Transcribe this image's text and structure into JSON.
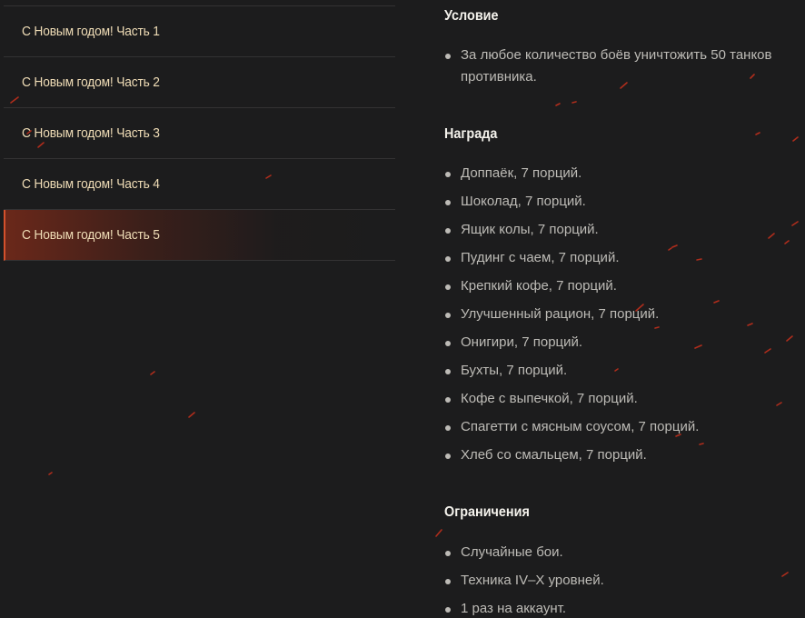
{
  "nav": {
    "items": [
      {
        "label": "С Новым годом! Часть 1",
        "active": false
      },
      {
        "label": "С Новым годом! Часть 2",
        "active": false
      },
      {
        "label": "С Новым годом! Часть 3",
        "active": false
      },
      {
        "label": "С Новым годом! Часть 4",
        "active": false
      },
      {
        "label": "С Новым годом! Часть 5",
        "active": true
      }
    ]
  },
  "conditions": {
    "title": "Условие",
    "items": [
      "За любое количество боёв уничтожить 50 танков противника."
    ]
  },
  "reward": {
    "title": "Награда",
    "items": [
      "Доппаёк, 7 порций.",
      "Шоколад, 7 порций.",
      "Ящик колы, 7 порций.",
      "Пудинг с чаем, 7 порций.",
      "Крепкий кофе, 7 порций.",
      "Улучшенный рацион, 7 порций.",
      "Онигири, 7 порций.",
      "Бухты, 7 порций.",
      "Кофе с выпечкой, 7 порций.",
      "Спагетти с мясным соусом, 7 порций.",
      "Хлеб со смальцем, 7 порций."
    ]
  },
  "restrictions": {
    "title": "Ограничения",
    "items": [
      "Случайные бои.",
      "Техника IV–X уровней.",
      "1 раз на аккаунт."
    ]
  },
  "colors": {
    "background": "#1c1c1d",
    "nav_text": "#efdcb6",
    "active_accent": "#d4512c",
    "heading": "#f4f2ec",
    "body_text": "#bdbbb6",
    "spark": "#c9301c"
  }
}
